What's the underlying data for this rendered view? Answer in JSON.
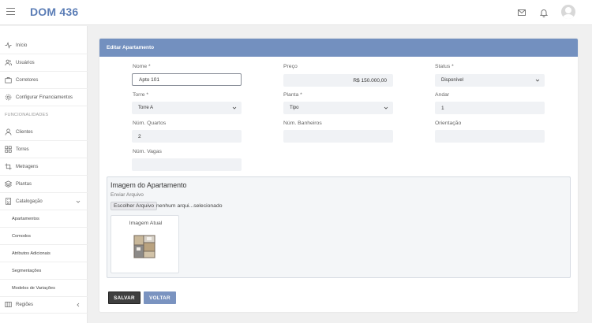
{
  "header": {
    "brand": "DOM 436",
    "menu_icon": "hamburger-icon",
    "mail_icon": "mail-icon",
    "bell_icon": "bell-icon",
    "avatar_icon": "user-avatar-icon"
  },
  "sidebar": {
    "items": [
      {
        "label": "Início",
        "icon": "activity-icon"
      },
      {
        "label": "Usuários",
        "icon": "users-icon"
      },
      {
        "label": "Corretores",
        "icon": "briefcase-icon"
      },
      {
        "label": "Configurar Financiamentos",
        "icon": "gear-icon"
      }
    ],
    "section_label": "FUNCIONALIDADES",
    "func_items": [
      {
        "label": "Clientes",
        "icon": "user-icon"
      },
      {
        "label": "Torres",
        "icon": "grid-icon"
      },
      {
        "label": "Metragens",
        "icon": "crop-icon"
      },
      {
        "label": "Plantas",
        "icon": "layers-icon"
      },
      {
        "label": "Catalogação",
        "icon": "building-icon"
      }
    ],
    "sub_items": [
      "Apartamentos",
      "Comodos",
      "Atributos Adicionais",
      "Segmentações",
      "Modelos de Variações"
    ],
    "last_item": {
      "label": "Regiões",
      "icon": "map-icon"
    }
  },
  "form": {
    "title": "Editar Apartamento",
    "nome": {
      "label": "Nome *",
      "value": "Apto 101"
    },
    "preco": {
      "label": "Preço",
      "value": "R$ 150.000,00"
    },
    "status": {
      "label": "Status *",
      "value": "Disponível"
    },
    "torre": {
      "label": "Torre *",
      "value": "Torre A"
    },
    "planta": {
      "label": "Planta *",
      "value": "Tipo"
    },
    "andar": {
      "label": "Andar",
      "value": "1"
    },
    "quartos": {
      "label": "Núm. Quartos",
      "value": "2"
    },
    "banheiros": {
      "label": "Núm. Banheiros",
      "value": ""
    },
    "orientacao": {
      "label": "Orientação",
      "value": ""
    },
    "vagas": {
      "label": "Núm. Vagas",
      "value": ""
    }
  },
  "image_section": {
    "title": "Imagem do Apartamento",
    "send_label": "Enviar Arquivo",
    "file_button": "Escolher Arquivo",
    "file_status": "nenhum arqui...selecionado",
    "current_label": "Imagem Atual"
  },
  "buttons": {
    "save": "SALVAR",
    "back": "VOLTAR"
  },
  "colors": {
    "brand": "#5b7db6",
    "card_header": "#7390bf",
    "save_button": "#3f3f3f",
    "back_button": "#7a93c0"
  }
}
